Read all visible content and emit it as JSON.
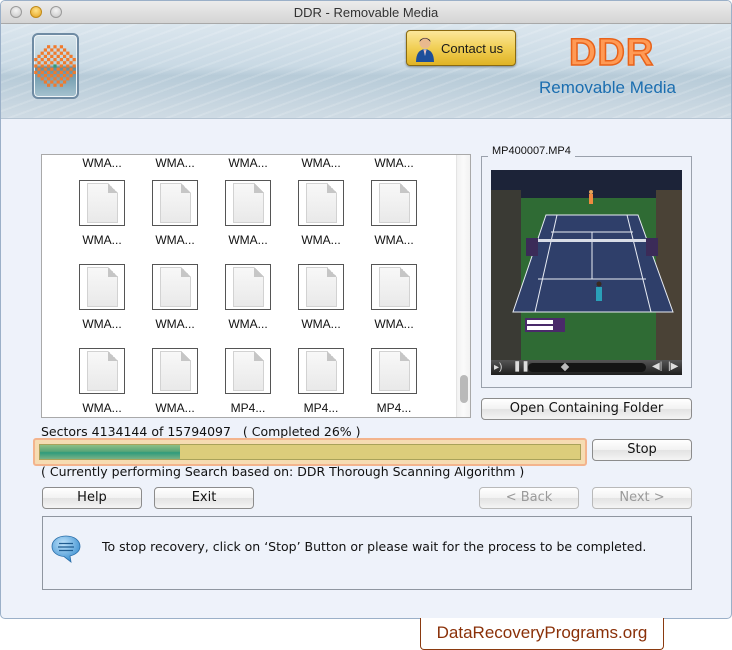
{
  "window": {
    "title": "DDR - Removable Media",
    "traffic_lights": [
      "close",
      "minimize",
      "zoom"
    ]
  },
  "banner": {
    "logo_icon": "ddr-app-logo-icon",
    "contact_button": "Contact us",
    "brand_name": "DDR",
    "brand_subtitle": "Removable Media",
    "colors": {
      "brand": "#ff8a3d",
      "subtitle": "#1b6eb0",
      "contact": "#f1cf55"
    }
  },
  "file_grid": {
    "partial_top_row": [
      "WMA...",
      "WMA...",
      "WMA...",
      "WMA...",
      "WMA..."
    ],
    "rows": [
      [
        "WMA...",
        "WMA...",
        "WMA...",
        "WMA...",
        "WMA..."
      ],
      [
        "WMA...",
        "WMA...",
        "WMA...",
        "WMA...",
        "WMA..."
      ],
      [
        "WMA...",
        "WMA...",
        "MP4...",
        "MP4...",
        "MP4..."
      ]
    ]
  },
  "preview": {
    "file_name": "MP400007.MP4",
    "controls": [
      "volume-icon",
      "pause-icon",
      "seek-slider",
      "step-back-icon",
      "step-forward-icon"
    ],
    "open_folder_button": "Open Containing Folder"
  },
  "progress": {
    "sectors_text": "Sectors 4134144 of 15794097   ( Completed 26% )",
    "percent": 26,
    "stop_button": "Stop",
    "algorithm_text": "( Currently performing Search based on: DDR Thorough Scanning Algorithm )"
  },
  "nav": {
    "help": "Help",
    "exit": "Exit",
    "back": "< Back",
    "next": "Next >"
  },
  "message": {
    "icon": "speech-bubble-icon",
    "text": "To stop recovery, click on ‘Stop’ Button or please wait for the process to be completed."
  },
  "watermark": "DataRecoveryPrograms.org"
}
